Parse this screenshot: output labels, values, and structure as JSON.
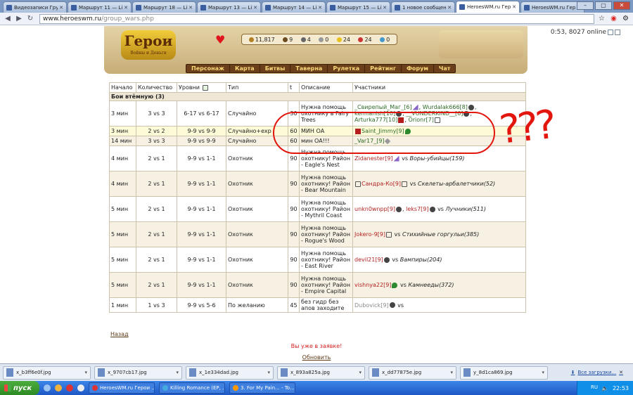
{
  "browser": {
    "tabs": [
      {
        "title": "Видеозаписи Груп"
      },
      {
        "title": "Маршрут 11 — Ligu"
      },
      {
        "title": "Маршрут 18 — Ligu"
      },
      {
        "title": "Маршрут 13 — Ligu"
      },
      {
        "title": "Маршрут 14 — Ligu"
      },
      {
        "title": "Маршрут 15 — Ligu"
      },
      {
        "title": "1 новое сообщени"
      },
      {
        "title": "HeroesWM.ru Герои"
      },
      {
        "title": "HeroesWM.ru Герои"
      }
    ],
    "active_tab": 7,
    "url_domain": "www.heroeswm.ru",
    "url_path": "/group_wars.php"
  },
  "header": {
    "logo": "Герои",
    "logo_sub": "Войны и Деньги",
    "resources": [
      "11,817",
      "9",
      "4",
      "0",
      "24",
      "24",
      "0"
    ],
    "online": "0:53, 8027 online",
    "menu": [
      "Персонаж",
      "Карта",
      "Битвы",
      "Таверна",
      "Рулетка",
      "Рейтинг",
      "Форум",
      "Чат"
    ]
  },
  "table": {
    "headers": [
      "Начало",
      "Количество",
      "Уровни",
      "Тип",
      "t",
      "Описание",
      "Участники"
    ],
    "group_title": "Бои втёмную (3)",
    "rows": [
      {
        "start": "3 мин",
        "count": "3 vs 3",
        "levels": "6-17 vs 6-17",
        "type": "Случайно",
        "t": "30",
        "desc": "Нужна помощь охотнику в Fairy Trees"
      },
      {
        "start": "3 мин",
        "count": "2 vs 2",
        "levels": "9-9 vs 9-9",
        "type": "Случайно+exp",
        "t": "60",
        "desc": "МИН ОА"
      },
      {
        "start": "14 мин",
        "count": "3 vs 3",
        "levels": "9-9 vs 9-9",
        "type": "Случайно",
        "t": "60",
        "desc": "мин ОА!!!"
      },
      {
        "start": "4 мин",
        "count": "2 vs 1",
        "levels": "9-9 vs 1-1",
        "type": "Охотник",
        "t": "90",
        "desc": "Нужна помощь охотнику! Район - Eagle's Nest"
      },
      {
        "start": "4 мин",
        "count": "2 vs 1",
        "levels": "9-9 vs 1-1",
        "type": "Охотник",
        "t": "90",
        "desc": "Нужна помощь охотнику! Район - Bear Mountain"
      },
      {
        "start": "5 мин",
        "count": "2 vs 1",
        "levels": "9-9 vs 1-1",
        "type": "Охотник",
        "t": "90",
        "desc": "Нужна помощь охотнику! Район - Mythril Coast"
      },
      {
        "start": "5 мин",
        "count": "2 vs 1",
        "levels": "9-9 vs 1-1",
        "type": "Охотник",
        "t": "90",
        "desc": "Нужна помощь охотнику! Район - Rogue's Wood"
      },
      {
        "start": "5 мин",
        "count": "2 vs 1",
        "levels": "9-9 vs 1-1",
        "type": "Охотник",
        "t": "90",
        "desc": "Нужна помощь охотнику! Район - East River"
      },
      {
        "start": "5 мин",
        "count": "2 vs 1",
        "levels": "9-9 vs 1-1",
        "type": "Охотник",
        "t": "90",
        "desc": "Нужна помощь охотнику! Район - Empire Capital"
      },
      {
        "start": "1 мин",
        "count": "1 vs 3",
        "levels": "9-9 vs 5-6",
        "type": "По желанию",
        "t": "45",
        "desc": "без гидр без апов заходите"
      }
    ],
    "participants": {
      "r0_a": "_Свирепый_Маг_[6]",
      "r0_b": "Wurdalak666[8]",
      "r0_c": "kermanish[10]",
      "r0_d": "__VUNDERKIND__[6]",
      "r0_e": "Arturka777[10]",
      "r0_f": "Orionr[7]",
      "r1_a": "Saint_Jimmy[9]",
      "r2_a": "_Var17_[9]",
      "r3_a": "Zidanester[9]",
      "r3_vs": "vs",
      "r3_mob": "Воры-убийцы(159)",
      "r4_a": "Сандра-Ко[9]",
      "r4_vs": "vs",
      "r4_mob": "Скелеты-арбалетчики(52)",
      "r5_a": "unkn0wnpp[9]",
      "r5_b": "leks7[9]",
      "r5_vs": "vs",
      "r5_mob": "Лучники(511)",
      "r6_a": "Jokero-9[9]",
      "r6_vs": "vs",
      "r6_mob": "Стихийные горгульи(385)",
      "r7_a": "devil21[9]",
      "r7_vs": "vs",
      "r7_mob": "Вампиры(204)",
      "r8_a": "vishnya22[9]",
      "r8_vs": "vs",
      "r8_mob": "Камнееды(372)",
      "r9_a": "Dubovick[9]",
      "r9_vs": "vs"
    }
  },
  "annotation": {
    "qmarks": "???"
  },
  "footer": {
    "back": "Назад",
    "message": "Вы уже в заявке!",
    "refresh": "Обновить"
  },
  "downloads": {
    "items": [
      "x_b3ff6e0f.jpg",
      "x_9707cb17.jpg",
      "x_1e334dad.jpg",
      "x_893a825a.jpg",
      "x_dd77875e.jpg",
      "y_8d1ca869.jpg"
    ],
    "all": "Все загрузки..."
  },
  "taskbar": {
    "start": "пуск",
    "tasks": [
      "HeroesWM.ru Герои ...",
      "Killing Romance (EP, ...",
      "3. For My Pain... - To..."
    ],
    "lang": "RU",
    "clock": "22:53"
  }
}
